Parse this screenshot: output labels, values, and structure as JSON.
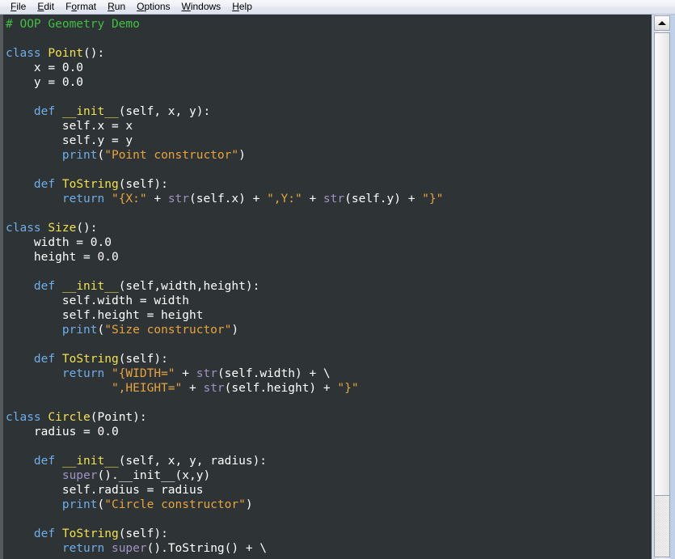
{
  "window": {
    "app": "IDLE Python Editor",
    "theme": "dark"
  },
  "menubar": {
    "items": [
      {
        "label": "File",
        "accel": "F",
        "rest": "ile"
      },
      {
        "label": "Edit",
        "accel": "E",
        "rest": "dit"
      },
      {
        "label": "Format",
        "accel": "F",
        "pre": "F",
        "rest": "rmat",
        "mid": "o"
      },
      {
        "label": "Run",
        "accel": "R",
        "rest": "un"
      },
      {
        "label": "Options",
        "accel": "O",
        "rest": "ptions"
      },
      {
        "label": "Windows",
        "accel": "W",
        "rest": "indows"
      },
      {
        "label": "Help",
        "accel": "H",
        "rest": "elp"
      }
    ]
  },
  "colors": {
    "background": "#2e3436",
    "default_text": "#ffffff",
    "comment": "#41bf41",
    "keyword": "#6faee8",
    "definition": "#f2e14c",
    "builtin": "#a292c4",
    "string": "#e8a33d",
    "menubar_bg": "#eef0f6",
    "scrollbar_bg": "#d7dbe5"
  },
  "scrollbar": {
    "orientation": "vertical",
    "arrow_up": "▲",
    "thumb_at_top": true
  },
  "editor": {
    "language": "Python",
    "lines": [
      [
        {
          "t": "com",
          "v": "# OOP Geometry Demo"
        }
      ],
      [],
      [
        {
          "t": "kw",
          "v": "class"
        },
        {
          "t": "def",
          "v": " "
        },
        {
          "t": "cls",
          "v": "Point"
        },
        {
          "t": "def",
          "v": "():"
        }
      ],
      [
        {
          "t": "def",
          "v": "    x = 0.0"
        }
      ],
      [
        {
          "t": "def",
          "v": "    y = 0.0"
        }
      ],
      [],
      [
        {
          "t": "def",
          "v": "    "
        },
        {
          "t": "kw",
          "v": "def"
        },
        {
          "t": "def",
          "v": " "
        },
        {
          "t": "cls",
          "v": "__init__"
        },
        {
          "t": "def",
          "v": "(self, x, y):"
        }
      ],
      [
        {
          "t": "def",
          "v": "        self.x = x"
        }
      ],
      [
        {
          "t": "def",
          "v": "        self.y = y"
        }
      ],
      [
        {
          "t": "def",
          "v": "        "
        },
        {
          "t": "fn",
          "v": "print"
        },
        {
          "t": "def",
          "v": "("
        },
        {
          "t": "str",
          "v": "\"Point constructor\""
        },
        {
          "t": "def",
          "v": ")"
        }
      ],
      [],
      [
        {
          "t": "def",
          "v": "    "
        },
        {
          "t": "kw",
          "v": "def"
        },
        {
          "t": "def",
          "v": " "
        },
        {
          "t": "cls",
          "v": "ToString"
        },
        {
          "t": "def",
          "v": "(self):"
        }
      ],
      [
        {
          "t": "def",
          "v": "        "
        },
        {
          "t": "kw",
          "v": "return"
        },
        {
          "t": "def",
          "v": " "
        },
        {
          "t": "str",
          "v": "\"{X:\""
        },
        {
          "t": "def",
          "v": " + "
        },
        {
          "t": "bui",
          "v": "str"
        },
        {
          "t": "def",
          "v": "(self.x) + "
        },
        {
          "t": "str",
          "v": "\",Y:\""
        },
        {
          "t": "def",
          "v": " + "
        },
        {
          "t": "bui",
          "v": "str"
        },
        {
          "t": "def",
          "v": "(self.y) + "
        },
        {
          "t": "str",
          "v": "\"}\""
        }
      ],
      [],
      [
        {
          "t": "kw",
          "v": "class"
        },
        {
          "t": "def",
          "v": " "
        },
        {
          "t": "cls",
          "v": "Size"
        },
        {
          "t": "def",
          "v": "():"
        }
      ],
      [
        {
          "t": "def",
          "v": "    width = 0.0"
        }
      ],
      [
        {
          "t": "def",
          "v": "    height = 0.0"
        }
      ],
      [],
      [
        {
          "t": "def",
          "v": "    "
        },
        {
          "t": "kw",
          "v": "def"
        },
        {
          "t": "def",
          "v": " "
        },
        {
          "t": "cls",
          "v": "__init__"
        },
        {
          "t": "def",
          "v": "(self,width,height):"
        }
      ],
      [
        {
          "t": "def",
          "v": "        self.width = width"
        }
      ],
      [
        {
          "t": "def",
          "v": "        self.height = height"
        }
      ],
      [
        {
          "t": "def",
          "v": "        "
        },
        {
          "t": "fn",
          "v": "print"
        },
        {
          "t": "def",
          "v": "("
        },
        {
          "t": "str",
          "v": "\"Size constructor\""
        },
        {
          "t": "def",
          "v": ")"
        }
      ],
      [],
      [
        {
          "t": "def",
          "v": "    "
        },
        {
          "t": "kw",
          "v": "def"
        },
        {
          "t": "def",
          "v": " "
        },
        {
          "t": "cls",
          "v": "ToString"
        },
        {
          "t": "def",
          "v": "(self):"
        }
      ],
      [
        {
          "t": "def",
          "v": "        "
        },
        {
          "t": "kw",
          "v": "return"
        },
        {
          "t": "def",
          "v": " "
        },
        {
          "t": "str",
          "v": "\"{WIDTH=\""
        },
        {
          "t": "def",
          "v": " + "
        },
        {
          "t": "bui",
          "v": "str"
        },
        {
          "t": "def",
          "v": "(self.width) + \\"
        }
      ],
      [
        {
          "t": "def",
          "v": "               "
        },
        {
          "t": "str",
          "v": "\",HEIGHT=\""
        },
        {
          "t": "def",
          "v": " + "
        },
        {
          "t": "bui",
          "v": "str"
        },
        {
          "t": "def",
          "v": "(self.height) + "
        },
        {
          "t": "str",
          "v": "\"}\""
        }
      ],
      [],
      [
        {
          "t": "kw",
          "v": "class"
        },
        {
          "t": "def",
          "v": " "
        },
        {
          "t": "cls",
          "v": "Circle"
        },
        {
          "t": "def",
          "v": "(Point):"
        }
      ],
      [
        {
          "t": "def",
          "v": "    radius = 0.0"
        }
      ],
      [],
      [
        {
          "t": "def",
          "v": "    "
        },
        {
          "t": "kw",
          "v": "def"
        },
        {
          "t": "def",
          "v": " "
        },
        {
          "t": "cls",
          "v": "__init__"
        },
        {
          "t": "def",
          "v": "(self, x, y, radius):"
        }
      ],
      [
        {
          "t": "def",
          "v": "        "
        },
        {
          "t": "bui",
          "v": "super"
        },
        {
          "t": "def",
          "v": "().__init__(x,y)"
        }
      ],
      [
        {
          "t": "def",
          "v": "        self.radius = radius"
        }
      ],
      [
        {
          "t": "def",
          "v": "        "
        },
        {
          "t": "fn",
          "v": "print"
        },
        {
          "t": "def",
          "v": "("
        },
        {
          "t": "str",
          "v": "\"Circle constructor\""
        },
        {
          "t": "def",
          "v": ")"
        }
      ],
      [],
      [
        {
          "t": "def",
          "v": "    "
        },
        {
          "t": "kw",
          "v": "def"
        },
        {
          "t": "def",
          "v": " "
        },
        {
          "t": "cls",
          "v": "ToString"
        },
        {
          "t": "def",
          "v": "(self):"
        }
      ],
      [
        {
          "t": "def",
          "v": "        "
        },
        {
          "t": "kw",
          "v": "return"
        },
        {
          "t": "def",
          "v": " "
        },
        {
          "t": "bui",
          "v": "super"
        },
        {
          "t": "def",
          "v": "().ToString() + \\"
        }
      ]
    ]
  }
}
